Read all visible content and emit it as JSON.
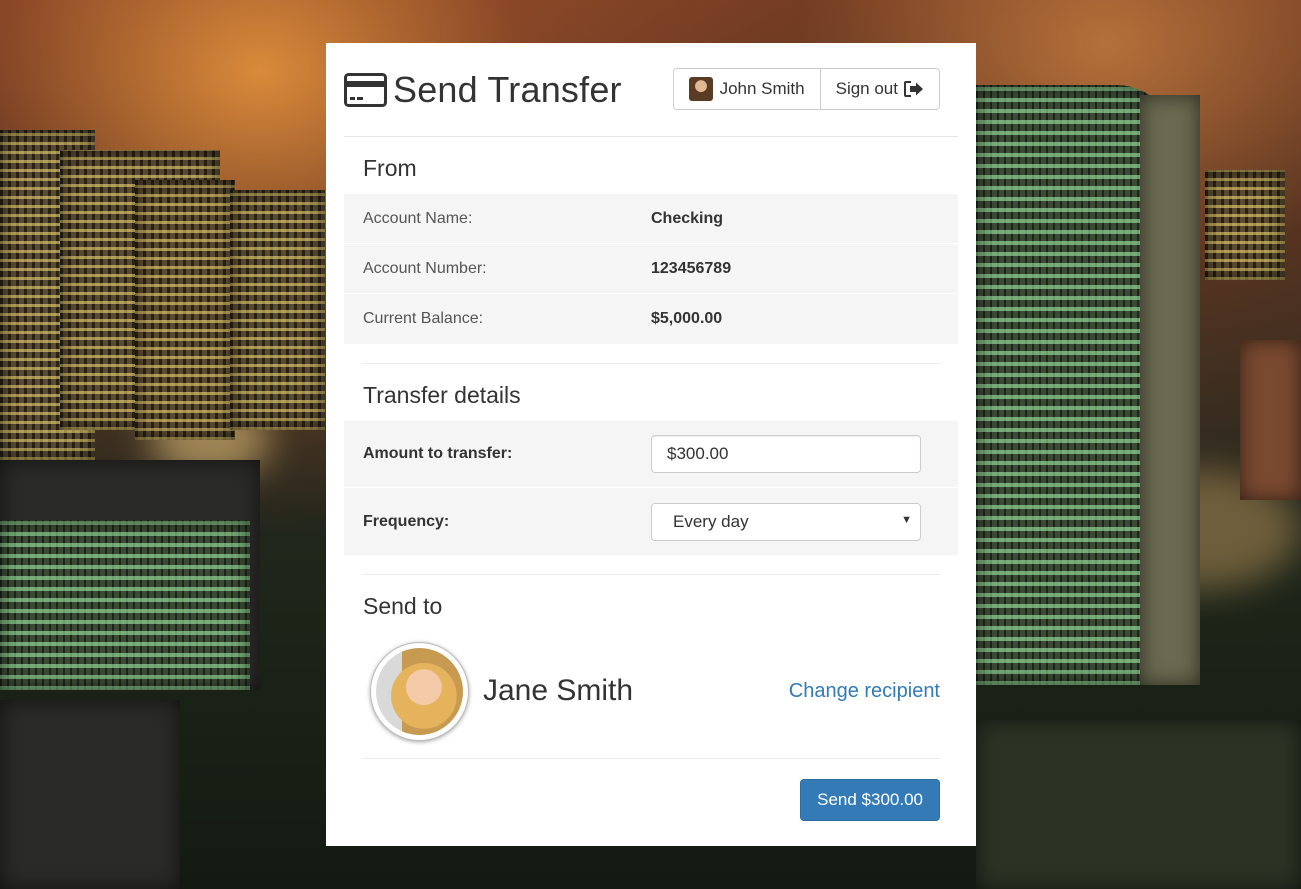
{
  "header": {
    "title": "Send Transfer",
    "user_name": "John Smith",
    "signout_label": "Sign out"
  },
  "from": {
    "title": "From",
    "rows": [
      {
        "label": "Account Name:",
        "value": "Checking"
      },
      {
        "label": "Account Number:",
        "value": "123456789"
      },
      {
        "label": "Current Balance:",
        "value": "$5,000.00"
      }
    ]
  },
  "transfer": {
    "title": "Transfer details",
    "amount_label": "Amount to transfer:",
    "amount_value": "$300.00",
    "frequency_label": "Frequency:",
    "frequency_value": "Every day"
  },
  "send_to": {
    "title": "Send to",
    "recipient_name": "Jane Smith",
    "change_label": "Change recipient"
  },
  "footer": {
    "send_label": "Send $300.00"
  },
  "colors": {
    "primary": "#337ab7",
    "row_bg": "#f5f5f5"
  },
  "icons": {
    "title": "credit-card-icon",
    "signout": "sign-out-icon",
    "select": "caret-down-icon"
  }
}
